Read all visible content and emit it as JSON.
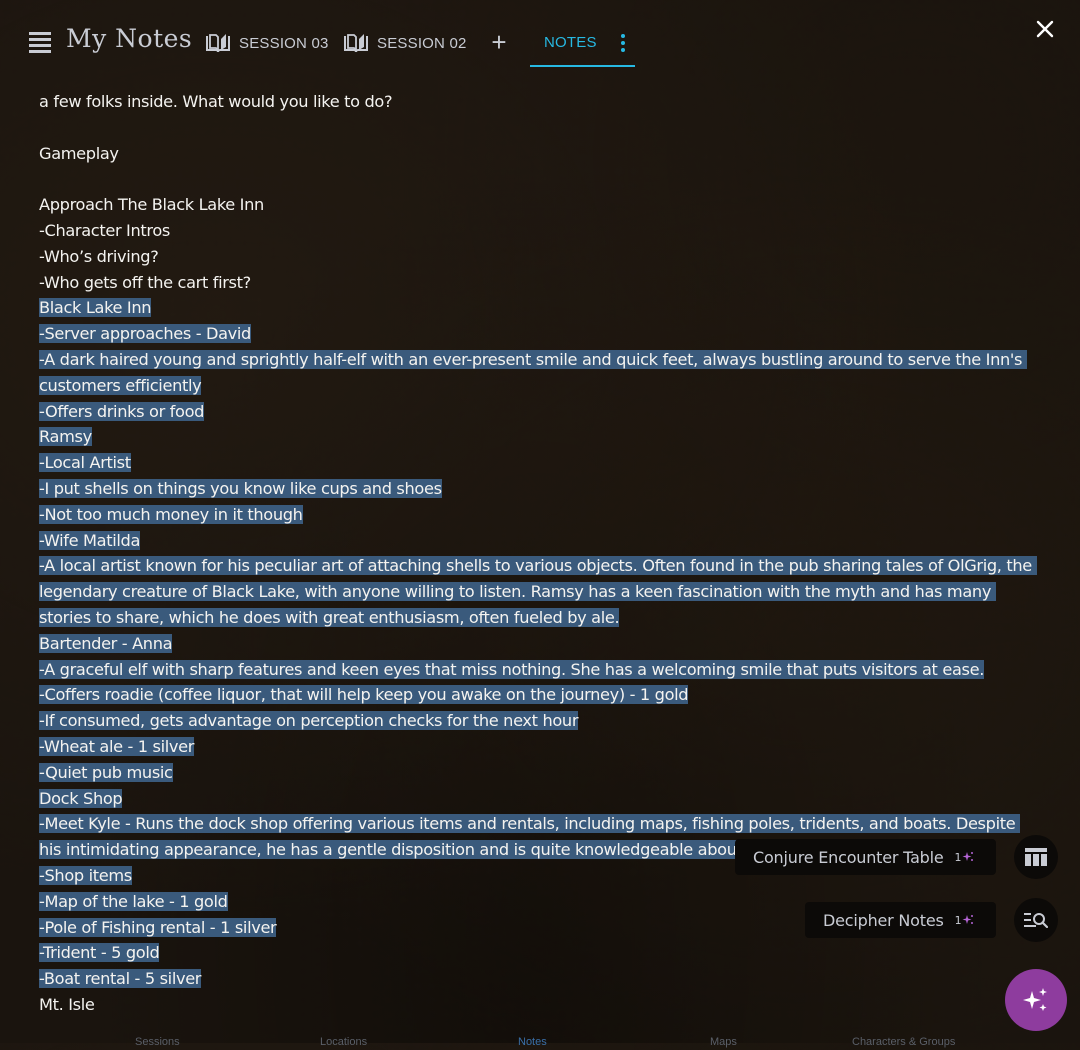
{
  "header": {
    "app_title": "My Notes",
    "tabs": [
      {
        "label": "SESSION 03",
        "icon": "book-open-icon"
      },
      {
        "label": "SESSION 02",
        "icon": "book-open-icon"
      }
    ],
    "add_tab_label": "+",
    "active_tab": {
      "label": "NOTES",
      "icon": "kebab-menu-icon"
    },
    "accent_color": "#27b9e3"
  },
  "notes": {
    "lines": [
      {
        "text": "a few folks inside. What would you like to do?",
        "selected": false
      },
      {
        "text": "",
        "selected": false
      },
      {
        "text": "Gameplay",
        "selected": false
      },
      {
        "text": "",
        "selected": false
      },
      {
        "text": "Approach The Black Lake Inn",
        "selected": false
      },
      {
        "text": "-Character Intros",
        "selected": false
      },
      {
        "text": "-Who’s driving?",
        "selected": false
      },
      {
        "text": "-Who gets off the cart first?",
        "selected": false
      },
      {
        "text": "Black Lake Inn",
        "selected": true
      },
      {
        "text": "-Server approaches - David",
        "selected": true
      },
      {
        "text": "-A dark haired young and sprightly half-elf with an ever-present smile and quick feet, always bustling around to serve the Inn's customers efficiently",
        "selected": true
      },
      {
        "text": "-Offers drinks or food",
        "selected": true
      },
      {
        "text": "Ramsy",
        "selected": true
      },
      {
        "text": "-Local Artist",
        "selected": true
      },
      {
        "text": "-I put shells on things you know like cups and shoes",
        "selected": true
      },
      {
        "text": "-Not too much money in it though",
        "selected": true
      },
      {
        "text": "-Wife Matilda",
        "selected": true
      },
      {
        "text": "-A local artist known for his peculiar art of attaching shells to various objects. Often found in the pub sharing tales of OlGrig, the legendary creature of Black Lake, with anyone willing to listen. Ramsy has a keen fascination with the myth and has many stories to share, which he does with great enthusiasm, often fueled by ale.",
        "selected": true
      },
      {
        "text": "Bartender - Anna",
        "selected": true
      },
      {
        "text": "-A graceful elf with sharp features and keen eyes that miss nothing. She has a welcoming smile that puts visitors at ease.",
        "selected": true
      },
      {
        "text": "-Coffers roadie (coffee liquor, that will help keep you awake on the journey) - 1 gold",
        "selected": true
      },
      {
        "text": "-If consumed, gets advantage on perception checks for the next hour",
        "selected": true
      },
      {
        "text": "-Wheat ale - 1 silver",
        "selected": true
      },
      {
        "text": "-Quiet pub music",
        "selected": true
      },
      {
        "text": "Dock Shop",
        "selected": true
      },
      {
        "text": "-Meet Kyle - Runs the dock shop offering various items and rentals, including maps, fishing poles, tridents, and boats. Despite his intimidating appearance, he has a gentle disposition and is quite knowledgeable about the",
        "selected": true
      },
      {
        "text": "-Shop items",
        "selected": true
      },
      {
        "text": "-Map of the lake - 1 gold",
        "selected": true
      },
      {
        "text": "-Pole of Fishing rental - 1 silver",
        "selected": true
      },
      {
        "text": "-Trident - 5 gold",
        "selected": true
      },
      {
        "text": "-Boat rental - 5 silver",
        "selected": true
      },
      {
        "text": "Mt. Isle",
        "selected": false
      }
    ],
    "selection_color": "#3a5a7c"
  },
  "actions": {
    "conjure": {
      "label": "Conjure Encounter Table",
      "credits": "1",
      "icon": "table-icon"
    },
    "decipher": {
      "label": "Decipher Notes",
      "credits": "1",
      "icon": "search-list-icon"
    },
    "fab": {
      "icon": "sparkles-icon",
      "color": "#8e3c9e"
    },
    "credit_icon_color": "#b565d6"
  },
  "bottom_nav": {
    "items": [
      {
        "label": "Sessions",
        "active": false
      },
      {
        "label": "Locations",
        "active": false
      },
      {
        "label": "Notes",
        "active": true
      },
      {
        "label": "Maps",
        "active": false
      },
      {
        "label": "Characters & Groups",
        "active": false
      }
    ]
  }
}
